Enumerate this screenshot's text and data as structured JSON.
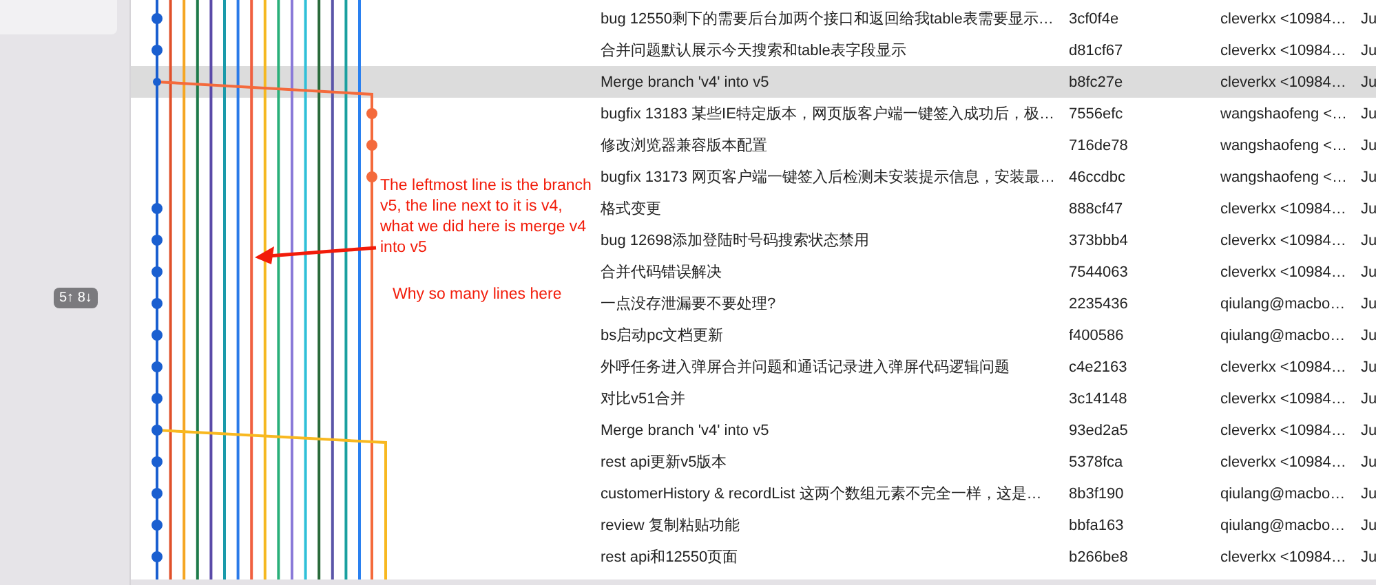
{
  "sidebar": {
    "sync_badge": "5↑ 8↓"
  },
  "commits": [
    {
      "message": "bug 12550剩下的需要后台加两个接口和返回给我table表需要显示…",
      "hash": "3cf0f4e",
      "author": "cleverkx <10984…",
      "date": "Ju",
      "selected": false,
      "kind": "commit"
    },
    {
      "message": "合并问题默认展示今天搜索和table表字段显示",
      "hash": "d81cf67",
      "author": "cleverkx <10984…",
      "date": "Ju",
      "selected": false,
      "kind": "commit"
    },
    {
      "message": "Merge branch 'v4' into v5",
      "hash": "b8fc27e",
      "author": "cleverkx <10984…",
      "date": "Ju",
      "selected": true,
      "kind": "merge"
    },
    {
      "message": "bugfix 13183 某些IE特定版本，网页版客户端一键签入成功后，极…",
      "hash": "7556efc",
      "author": "wangshaofeng <…",
      "date": "Ju",
      "selected": false,
      "kind": "side"
    },
    {
      "message": "修改浏览器兼容版本配置",
      "hash": "716de78",
      "author": "wangshaofeng <…",
      "date": "Ju",
      "selected": false,
      "kind": "side"
    },
    {
      "message": "bugfix 13173 网页客户端一键签入后检测未安装提示信息，安装最…",
      "hash": "46ccdbc",
      "author": "wangshaofeng <…",
      "date": "Ju",
      "selected": false,
      "kind": "side"
    },
    {
      "message": "格式变更",
      "hash": "888cf47",
      "author": "cleverkx <10984…",
      "date": "Ju",
      "selected": false,
      "kind": "commit"
    },
    {
      "message": "bug 12698添加登陆时号码搜索状态禁用",
      "hash": "373bbb4",
      "author": "cleverkx <10984…",
      "date": "Ju",
      "selected": false,
      "kind": "commit"
    },
    {
      "message": "合并代码错误解决",
      "hash": "7544063",
      "author": "cleverkx <10984…",
      "date": "Ju",
      "selected": false,
      "kind": "commit"
    },
    {
      "message": "一点没存泄漏要不要处理?",
      "hash": "2235436",
      "author": "qiulang@macbo…",
      "date": "Ju",
      "selected": false,
      "kind": "commit"
    },
    {
      "message": "bs启动pc文档更新",
      "hash": "f400586",
      "author": "qiulang@macbo…",
      "date": "Ju",
      "selected": false,
      "kind": "commit"
    },
    {
      "message": "外呼任务进入弹屏合并问题和通话记录进入弹屏代码逻辑问题",
      "hash": "c4e2163",
      "author": "cleverkx <10984…",
      "date": "Ju",
      "selected": false,
      "kind": "commit"
    },
    {
      "message": "对比v51合并",
      "hash": "3c14148",
      "author": "cleverkx <10984…",
      "date": "Ju",
      "selected": false,
      "kind": "commit"
    },
    {
      "message": "Merge branch 'v4' into v5",
      "hash": "93ed2a5",
      "author": "cleverkx <10984…",
      "date": "Ju",
      "selected": false,
      "kind": "merge"
    },
    {
      "message": "rest  api更新v5版本",
      "hash": "5378fca",
      "author": "cleverkx <10984…",
      "date": "Ju",
      "selected": false,
      "kind": "commit"
    },
    {
      "message": "customerHistory & recordList 这两个数组元素不完全一样，这是…",
      "hash": "8b3f190",
      "author": "qiulang@macbo…",
      "date": "Ju",
      "selected": false,
      "kind": "commit"
    },
    {
      "message": "review 复制粘贴功能",
      "hash": "bbfa163",
      "author": "qiulang@macbo…",
      "date": "Ju",
      "selected": false,
      "kind": "commit"
    },
    {
      "message": "rest api和12550页面",
      "hash": "b266be8",
      "author": "cleverkx <10984…",
      "date": "Ju",
      "selected": false,
      "kind": "commit"
    }
  ],
  "annotation": {
    "note": "The leftmost line is the branch v5, the line next to it is v4, what we did here is merge v4 into v5",
    "question": "Why so many lines here"
  }
}
